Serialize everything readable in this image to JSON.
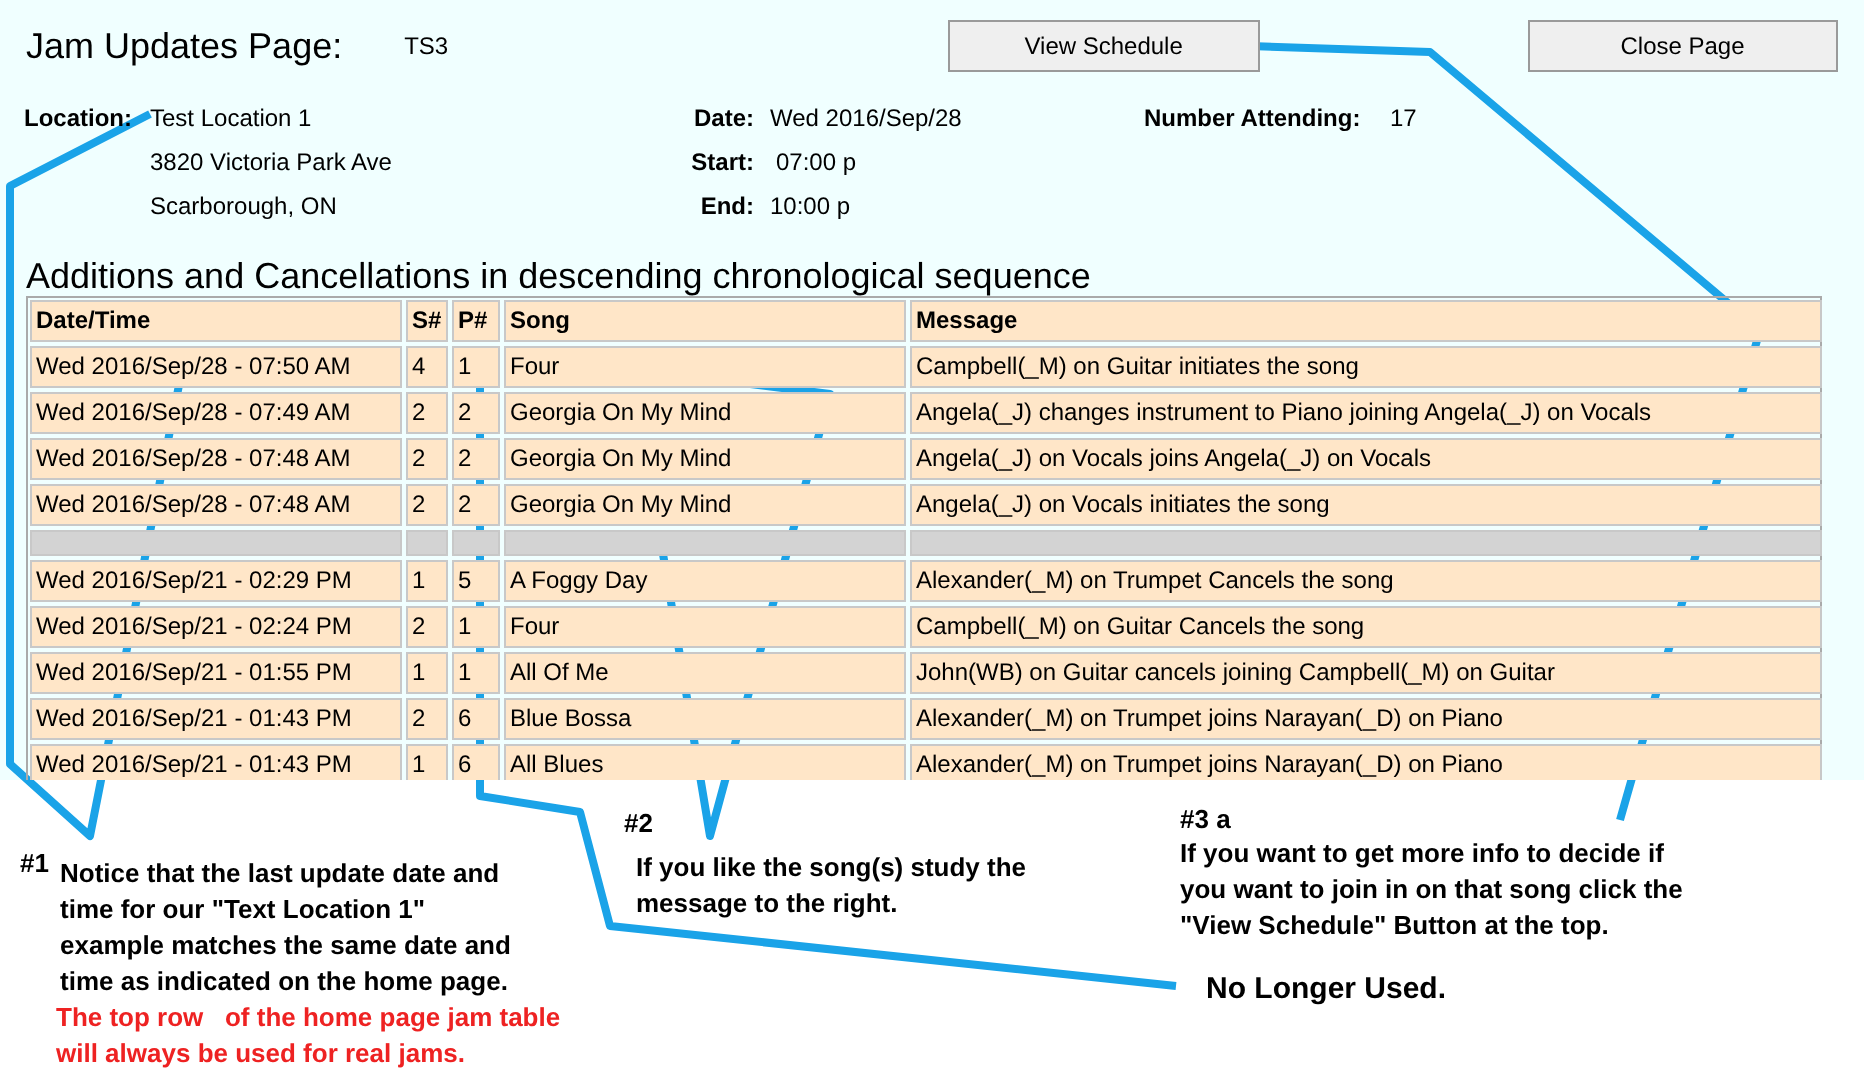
{
  "header": {
    "title": "Jam Updates Page:",
    "code": "TS3",
    "buttons": [
      "View Schedule",
      "Close Page"
    ]
  },
  "info": {
    "location": {
      "label": "Location:",
      "lines": [
        "Test Location 1",
        "3820 Victoria Park Ave",
        "Scarborough, ON"
      ]
    },
    "schedule": [
      {
        "label": "Date:",
        "value": "Wed 2016/Sep/28"
      },
      {
        "label": "Start:",
        "value": "07:00 p"
      },
      {
        "label": "End:",
        "value": "10:00 p"
      }
    ],
    "attending": {
      "label": "Number Attending:",
      "value": "17"
    }
  },
  "section_title": "Additions and Cancellations in descending chronological sequence",
  "table": {
    "columns": [
      "Date/Time",
      "S#",
      "P#",
      "Song",
      "Message"
    ],
    "rows": [
      {
        "kind": "entry",
        "cells": [
          "Wed 2016/Sep/28 - 07:50 AM",
          "4",
          "1",
          "Four",
          "Campbell(_M) on Guitar initiates the song"
        ]
      },
      {
        "kind": "entry",
        "cells": [
          "Wed 2016/Sep/28 - 07:49 AM",
          "2",
          "2",
          "Georgia On My Mind",
          "Angela(_J) changes instrument to Piano joining Angela(_J) on Vocals"
        ]
      },
      {
        "kind": "entry",
        "cells": [
          "Wed 2016/Sep/28 - 07:48 AM",
          "2",
          "2",
          "Georgia On My Mind",
          "Angela(_J) on Vocals joins Angela(_J) on Vocals"
        ]
      },
      {
        "kind": "entry",
        "cells": [
          "Wed 2016/Sep/28 - 07:48 AM",
          "2",
          "2",
          "Georgia On My Mind",
          "Angela(_J) on Vocals initiates the song"
        ]
      },
      {
        "kind": "separator"
      },
      {
        "kind": "entry",
        "cells": [
          "Wed 2016/Sep/21 - 02:29 PM",
          "1",
          "5",
          "A Foggy Day",
          "Alexander(_M) on Trumpet Cancels the song"
        ]
      },
      {
        "kind": "entry",
        "cells": [
          "Wed 2016/Sep/21 - 02:24 PM",
          "2",
          "1",
          "Four",
          "Campbell(_M) on Guitar Cancels the song"
        ]
      },
      {
        "kind": "entry",
        "cells": [
          "Wed 2016/Sep/21 - 01:55 PM",
          "1",
          "1",
          "All Of Me",
          "John(WB) on Guitar cancels joining Campbell(_M) on Guitar"
        ]
      },
      {
        "kind": "entry",
        "cells": [
          "Wed 2016/Sep/21 - 01:43 PM",
          "2",
          "6",
          "Blue Bossa",
          "Alexander(_M) on Trumpet joins Narayan(_D) on Piano"
        ]
      },
      {
        "kind": "entry",
        "cells": [
          "Wed 2016/Sep/21 - 01:43 PM",
          "1",
          "6",
          "All Blues",
          "Alexander(_M) on Trumpet joins Narayan(_D) on Piano"
        ]
      }
    ]
  },
  "annotations": [
    {
      "marker": "#1",
      "lines": [
        "Notice that the last update date and",
        "time for our \"Text Location 1\"",
        "example matches the same date and",
        "time as indicated on the home page."
      ],
      "note": [
        "The top row   of the home page jam table",
        "will always be used for real jams."
      ]
    },
    {
      "marker": "#2",
      "lines": [
        "If you like the song(s) study the",
        "message to the right."
      ]
    },
    {
      "marker": "#3 a",
      "lines": [
        "If you want to get more info to decide if",
        "you want to join in on that song click the",
        "\"View Schedule\" Button at the top."
      ]
    },
    {
      "lines": [
        "No Longer Used."
      ]
    }
  ]
}
